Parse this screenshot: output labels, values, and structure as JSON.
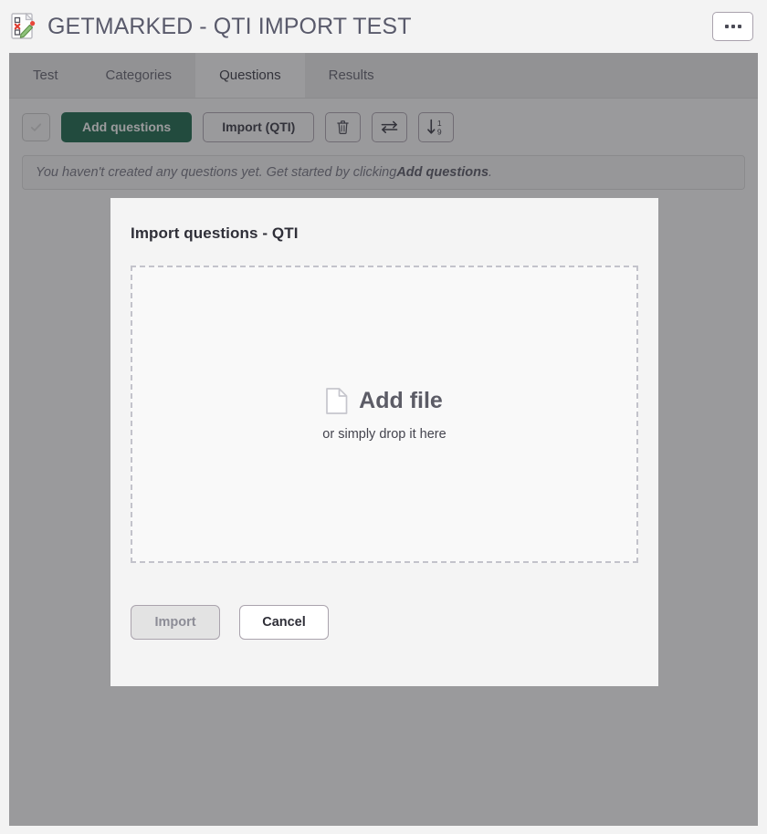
{
  "header": {
    "icon": "quiz-document-pencil-icon",
    "title": "GETMARKED - QTI IMPORT TEST",
    "more_button": {
      "name": "more-options-button",
      "label": "•••"
    }
  },
  "tabs": [
    {
      "id": "test",
      "label": "Test",
      "active": false
    },
    {
      "id": "categories",
      "label": "Categories",
      "active": false
    },
    {
      "id": "questions",
      "label": "Questions",
      "active": true
    },
    {
      "id": "results",
      "label": "Results",
      "active": false
    }
  ],
  "toolbar": {
    "select_all_checkbox": "select-all-checkbox",
    "add_questions_label": "Add questions",
    "import_qti_label": "Import (QTI)",
    "delete_icon": "trash-icon",
    "exchange_icon": "exchange-arrows-icon",
    "sort_icon": "sort-numeric-down-icon",
    "sort_icon_top_digit": "1",
    "sort_icon_bottom_digit": "9"
  },
  "empty_state": {
    "text_before": "You haven't created any questions yet. Get started by clicking ",
    "text_bold": "Add questions",
    "text_after": "."
  },
  "modal": {
    "title": "Import questions - QTI",
    "dropzone": {
      "icon": "file-document-icon",
      "label": "Add file",
      "sub_label": "or simply drop it here"
    },
    "import_label": "Import",
    "import_disabled": true,
    "cancel_label": "Cancel"
  },
  "colors": {
    "primary_green": "#1d6b4f",
    "title_text": "#595a6b",
    "modal_bg": "#f4f4f4",
    "overlay": "rgba(40,40,44,0.47)",
    "border_grey": "#b0a9b3",
    "dropzone_border": "#c3c3cb"
  }
}
